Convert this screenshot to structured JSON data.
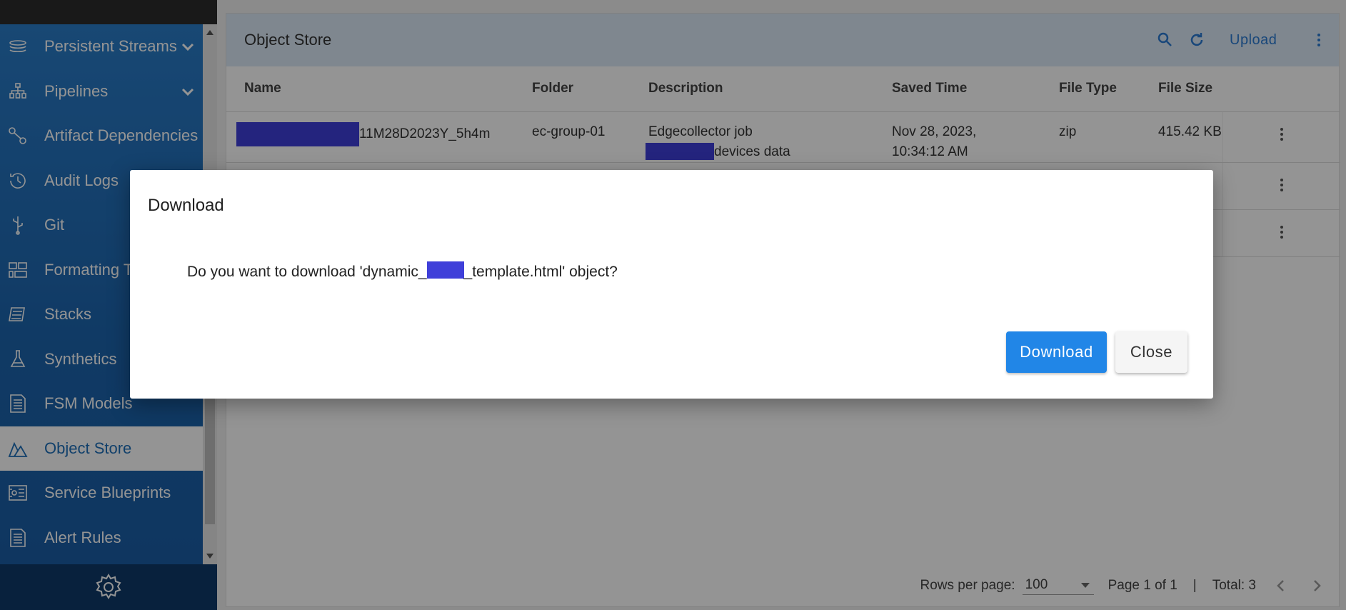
{
  "sidebar": {
    "items": [
      {
        "label": "Persistent Streams",
        "icon": "streams-icon",
        "expandable": true
      },
      {
        "label": "Pipelines",
        "icon": "pipelines-icon",
        "expandable": true
      },
      {
        "label": "Artifact Dependencies",
        "icon": "dependencies-icon"
      },
      {
        "label": "Audit Logs",
        "icon": "history-icon"
      },
      {
        "label": "Git",
        "icon": "git-icon"
      },
      {
        "label": "Formatting T",
        "icon": "formatting-icon"
      },
      {
        "label": "Stacks",
        "icon": "stacks-icon"
      },
      {
        "label": "Synthetics",
        "icon": "flask-icon"
      },
      {
        "label": "FSM Models",
        "icon": "document-icon"
      },
      {
        "label": "Object Store",
        "icon": "object-store-icon",
        "active": true
      },
      {
        "label": "Service Blueprints",
        "icon": "blueprint-icon"
      },
      {
        "label": "Alert Rules",
        "icon": "document-icon"
      }
    ],
    "footer_icon": "gear-icon"
  },
  "main": {
    "title": "Object Store",
    "upload_label": "Upload",
    "columns": [
      "Name",
      "Folder",
      "Description",
      "Saved Time",
      "File Type",
      "File Size"
    ],
    "rows": [
      {
        "name_suffix": "11M28D2023Y_5h4m",
        "folder": "ec-group-01",
        "description_line1": "Edgecollector job",
        "description_line2_suffix": "devices data",
        "saved_time_line1": "Nov 28, 2023,",
        "saved_time_line2": "10:34:12 AM",
        "file_type": "zip",
        "file_size": "415.42 KB"
      }
    ]
  },
  "pager": {
    "rows_per_page_label": "Rows per page:",
    "rows_per_page_value": "100",
    "page_label": "Page 1 of 1",
    "separator": "|",
    "total_label": "Total: 3"
  },
  "dialog": {
    "title": "Download",
    "message_prefix": "Do you want to download 'dynamic_",
    "message_suffix": "_template.html' object?",
    "download_label": "Download",
    "close_label": "Close"
  },
  "colors": {
    "sidebar": "#1e6fb8",
    "accent": "#2186e7",
    "redaction": "#3f3fd9"
  }
}
